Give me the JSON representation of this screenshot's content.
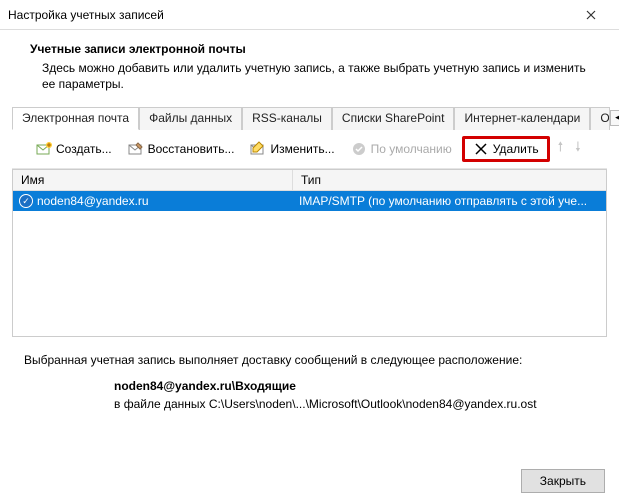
{
  "window": {
    "title": "Настройка учетных записей"
  },
  "header": {
    "heading": "Учетные записи электронной почты",
    "description": "Здесь можно добавить или удалить учетную запись, а также выбрать учетную запись и изменить ее параметры."
  },
  "tabs": {
    "items": [
      "Электронная почта",
      "Файлы данных",
      "RSS-каналы",
      "Списки SharePoint",
      "Интернет-календари",
      "Опублико"
    ]
  },
  "toolbar": {
    "create": "Создать...",
    "restore": "Восстановить...",
    "edit": "Изменить...",
    "default": "По умолчанию",
    "delete": "Удалить"
  },
  "list": {
    "col_name": "Имя",
    "col_type": "Тип",
    "rows": [
      {
        "name": "noden84@yandex.ru",
        "type": "IMAP/SMTP (по умолчанию отправлять с этой уче..."
      }
    ]
  },
  "delivery": {
    "intro": "Выбранная учетная запись выполняет доставку сообщений в следующее расположение:",
    "bold_path": "noden84@yandex.ru\\Входящие",
    "file_line": "в файле данных C:\\Users\\noden\\...\\Microsoft\\Outlook\\noden84@yandex.ru.ost"
  },
  "footer": {
    "close": "Закрыть"
  }
}
